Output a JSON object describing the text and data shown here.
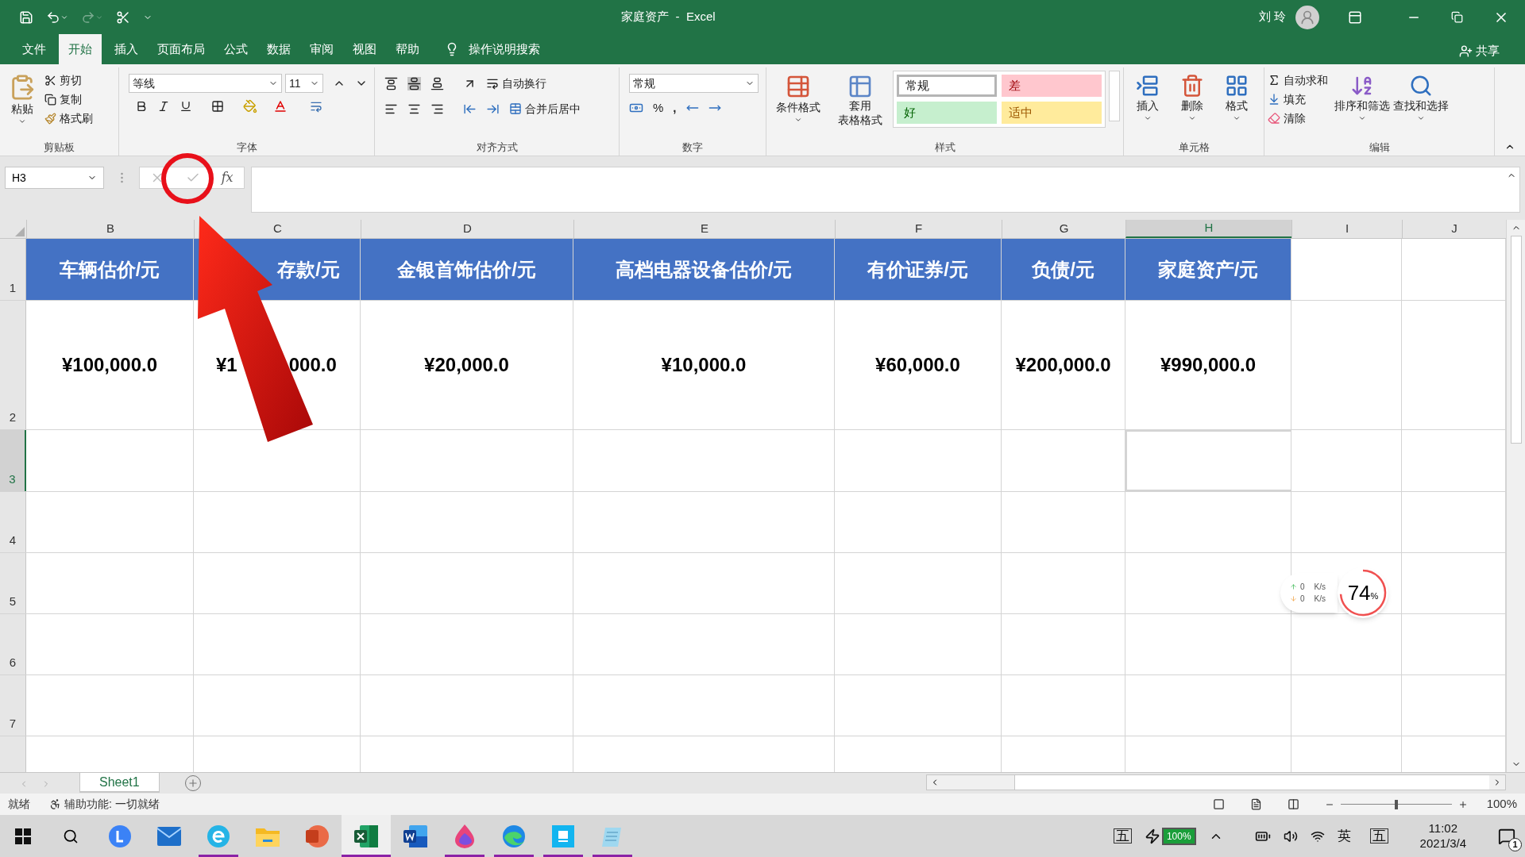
{
  "window": {
    "title": "家庭资产  -  Excel",
    "user": "刘 玲"
  },
  "ribbon_tabs": [
    {
      "label": "文件",
      "selected": false
    },
    {
      "label": "开始",
      "selected": true
    },
    {
      "label": "插入",
      "selected": false
    },
    {
      "label": "页面布局",
      "selected": false
    },
    {
      "label": "公式",
      "selected": false
    },
    {
      "label": "数据",
      "selected": false
    },
    {
      "label": "审阅",
      "selected": false
    },
    {
      "label": "视图",
      "selected": false
    },
    {
      "label": "帮助",
      "selected": false
    }
  ],
  "tell_me": "操作说明搜索",
  "share": "共享",
  "clipboard": {
    "paste": "粘贴",
    "cut": "剪切",
    "copy": "复制",
    "format_painter": "格式刷",
    "label": "剪贴板"
  },
  "font": {
    "name": "等线",
    "size": "11",
    "label": "字体"
  },
  "alignment": {
    "wrap": "自动换行",
    "merge": "合并后居中",
    "label": "对齐方式"
  },
  "number": {
    "format": "常规",
    "percent": "%",
    "comma": ",",
    "label": "数字"
  },
  "styles": {
    "conditional": "条件格式",
    "table_line1": "套用",
    "table_line2": "表格格式",
    "label": "样式",
    "cell_styles": [
      {
        "label": "常规",
        "kind": "normal",
        "selected": true
      },
      {
        "label": "差",
        "kind": "bad",
        "selected": false
      },
      {
        "label": "好",
        "kind": "good",
        "selected": false
      },
      {
        "label": "适中",
        "kind": "neutral",
        "selected": false
      }
    ]
  },
  "cells": {
    "insert": "插入",
    "delete": "删除",
    "format": "格式",
    "label": "单元格"
  },
  "editing": {
    "autosum": "自动求和",
    "fill": "填充",
    "clear": "清除",
    "sort": "排序和筛选",
    "find": "查找和选择",
    "label": "编辑"
  },
  "formula_bar": {
    "name_box": "H3",
    "fx": "fx"
  },
  "columns": [
    {
      "label": "B",
      "selected": false
    },
    {
      "label": "C",
      "selected": false
    },
    {
      "label": "D",
      "selected": false
    },
    {
      "label": "E",
      "selected": false
    },
    {
      "label": "F",
      "selected": false
    },
    {
      "label": "G",
      "selected": false
    },
    {
      "label": "H",
      "selected": true
    },
    {
      "label": "I",
      "selected": false
    },
    {
      "label": "J",
      "selected": false
    }
  ],
  "rows": [
    {
      "label": "1",
      "kind": "header",
      "selected": false,
      "cells": [
        "车辆估价/元",
        "存款/元",
        "金银首饰估价/元",
        "高档电器设备估价/元",
        "有价证券/元",
        "负债/元",
        "家庭资产/元"
      ]
    },
    {
      "label": "2",
      "kind": "value",
      "selected": false,
      "cells": [
        "¥100,000.0",
        [
          "¥1",
          "000.0"
        ],
        "¥20,000.0",
        "¥10,000.0",
        "¥60,000.0",
        "¥200,000.0",
        "¥990,000.0"
      ]
    },
    {
      "label": "3",
      "kind": "empty",
      "selected": true
    },
    {
      "label": "4",
      "kind": "empty",
      "selected": false
    },
    {
      "label": "5",
      "kind": "empty",
      "selected": false
    },
    {
      "label": "6",
      "kind": "empty",
      "selected": false
    },
    {
      "label": "7",
      "kind": "empty",
      "selected": false
    }
  ],
  "sheet_tabs": [
    {
      "label": "Sheet1",
      "selected": true
    }
  ],
  "status": {
    "ready": "就绪",
    "accessibility": "辅助功能: 一切就绪",
    "zoom": "100%",
    "zoom_slider": {
      "level": 0.5
    }
  },
  "speed_widget": {
    "up": "0",
    "down": "0",
    "unit_up": "K/s",
    "unit_down": "K/s",
    "percent": "74",
    "percent_sign": "%"
  },
  "taskbar": {
    "apps": [
      {
        "kind": "lapp",
        "running": false
      },
      {
        "kind": "mail",
        "running": false
      },
      {
        "kind": "ebrowser",
        "running": true
      },
      {
        "kind": "folder",
        "running": false
      },
      {
        "kind": "powerpoint",
        "running": false
      },
      {
        "kind": "excel",
        "running": true,
        "selected": true
      },
      {
        "kind": "word",
        "running": false
      },
      {
        "kind": "paint",
        "running": true
      },
      {
        "kind": "edge",
        "running": true
      },
      {
        "kind": "bluebox",
        "running": true
      },
      {
        "kind": "notepad",
        "running": true
      }
    ],
    "ime": "五",
    "battery": "100%",
    "lang": "英",
    "ime2": "五",
    "time": "11:02",
    "date": "2021/3/4",
    "notifications": "1"
  }
}
